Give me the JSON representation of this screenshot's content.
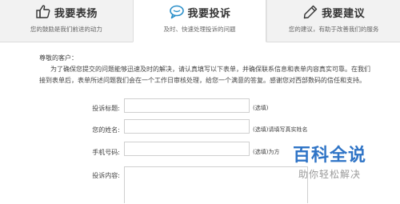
{
  "tabs": [
    {
      "title": "我要表扬",
      "subtitle": "您的鼓励是我们前进的动力",
      "icon": "thumbs-up-icon"
    },
    {
      "title": "我要投诉",
      "subtitle": "及时、快速处理投诉的问题",
      "icon": "speech-bubble-icon"
    },
    {
      "title": "我要建议",
      "subtitle": "您的建议，有助于改善我们的服务",
      "icon": "pencil-icon"
    }
  ],
  "active_tab": 1,
  "greeting": "尊敬的客户：",
  "intro": "为了确保您提交的问题能够迅速及时的解决，请认真填写以下表单，并确保联系信息和表单内容真实可靠。在我们接到表单后，表单所述问题我们会在一个工作日审核处理，给您一个满意的答复。感谢您对西部数码的信任和支持。",
  "form": {
    "title_label": "投诉标题:",
    "title_hint": "(选填)",
    "name_label": "您的姓名:",
    "name_hint": "(选填)请填写真实姓名",
    "phone_label": "手机号码:",
    "phone_hint": "(选填)为方",
    "content_label": "投诉内容:"
  },
  "watermark": {
    "title": "百科全说",
    "subtitle": "助你轻松解决"
  },
  "colors": {
    "watermark_blue": "#2f74c6",
    "tab_inactive_bg": "#f2f2f2"
  }
}
